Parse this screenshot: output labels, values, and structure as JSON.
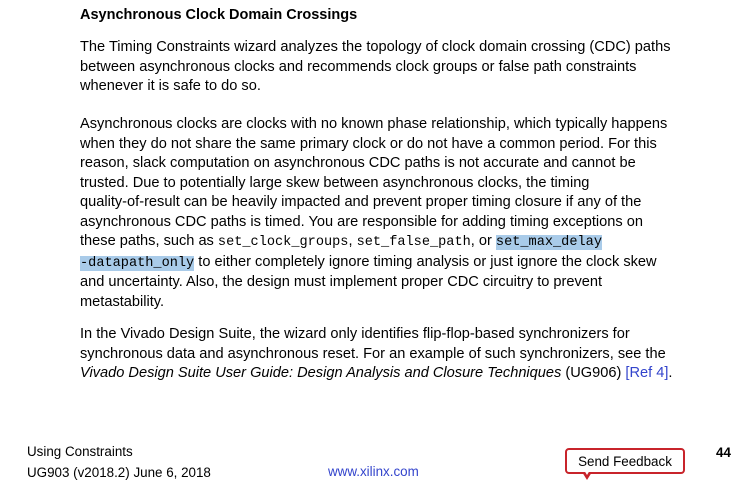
{
  "heading": "Asynchronous Clock Domain Crossings",
  "para1": {
    "lines": [
      "The Timing Constraints wizard analyzes the topology of clock domain crossing (CDC) paths",
      "between asynchronous clocks and recommends clock groups or false path constraints",
      "whenever it is safe to do so."
    ]
  },
  "para2": {
    "lines": [
      "Asynchronous clocks are clocks with no known phase relationship, which typically happens",
      "when they do not share the same primary clock or do not have a common period. For this",
      "reason, slack computation on asynchronous CDC paths is not accurate and cannot be",
      "trusted. Due to potentially large skew between asynchronous clocks, the timing",
      "quality-of-result can be heavily impacted and prevent proper timing closure if any of the",
      "asynchronous CDC paths is timed. You are responsible for adding timing exceptions on"
    ],
    "line7_prefix": "these paths, such as ",
    "code1": "set_clock_groups",
    "sep1": ", ",
    "code2": "set_false_path",
    "sep2": ", or ",
    "code3a": "set_max_delay",
    "code3b": "-datapath_only",
    "line8_suffix": " to either completely ignore timing analysis or just ignore the clock skew",
    "tail_lines": [
      "and uncertainty. Also, the design must implement proper CDC circuitry to prevent",
      "metastability."
    ]
  },
  "para3": {
    "lines": [
      "In the Vivado Design Suite, the wizard only identifies flip-flop-based synchronizers for",
      "synchronous data and asynchronous reset. For an example of such synchronizers, see the"
    ],
    "italic_ref": "Vivado Design Suite User Guide: Design Analysis and Closure Techniques",
    "ref_code": " (UG906) ",
    "ref_link": "[Ref 4]",
    "end": "."
  },
  "footer": {
    "doc_title": "Using Constraints",
    "doc_id": "UG903 (v2018.2) June 6, 2018",
    "url": "www.xilinx.com",
    "feedback_label": "Send Feedback",
    "page_number": "44"
  },
  "colors": {
    "highlight": "#a9cbe9",
    "link": "#3344cc",
    "feedback_border": "#c8242b"
  }
}
